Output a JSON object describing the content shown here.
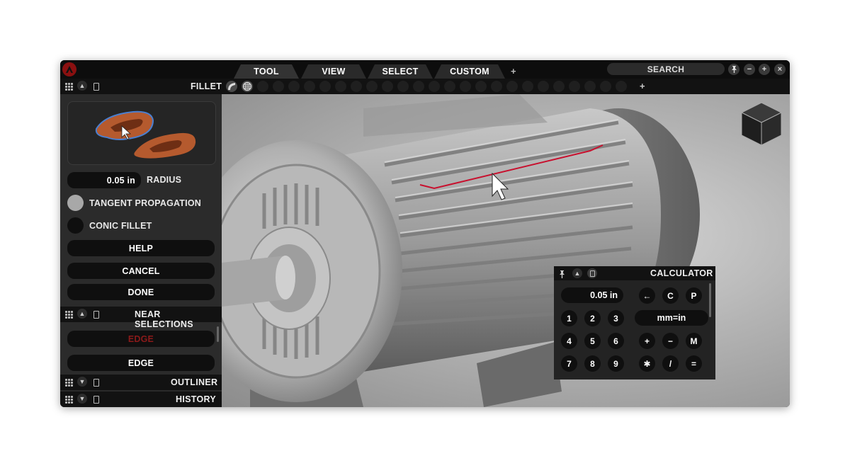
{
  "tabs": [
    {
      "label": "TOOL",
      "active": true
    },
    {
      "label": "VIEW",
      "active": false
    },
    {
      "label": "SELECT",
      "active": false
    },
    {
      "label": "CUSTOM",
      "active": false
    }
  ],
  "add_tab_label": "+",
  "search": {
    "label": "SEARCH"
  },
  "window_buttons": {
    "pin_icon": "pin-icon",
    "minimize": "−",
    "maximize": "+",
    "close": "×"
  },
  "toolbar": {
    "title": "FILLET",
    "add_label": "+"
  },
  "fillet": {
    "radius_value": "0.05 in",
    "radius_label": "RADIUS",
    "tangent_label": "TANGENT PROPAGATION",
    "conic_label": "CONIC FILLET",
    "help_label": "HELP",
    "cancel_label": "CANCEL",
    "done_label": "DONE"
  },
  "near_selections": {
    "title": "NEAR SELECTIONS",
    "items": [
      {
        "label": "EDGE",
        "color": "#8a1a1a"
      },
      {
        "label": "EDGE",
        "color": "#ffffff"
      }
    ]
  },
  "outliner": {
    "title": "OUTLINER"
  },
  "history": {
    "title": "HISTORY"
  },
  "calculator": {
    "title": "CALCULATOR",
    "display": "0.05 in",
    "back_label": "←",
    "clear_label": "C",
    "p_label": "P",
    "convert_label": "mm=in",
    "digits": [
      "1",
      "2",
      "3",
      "4",
      "5",
      "6",
      "7",
      "8",
      "9"
    ],
    "plus": "+",
    "minus": "−",
    "memory": "M",
    "multiply": "✱",
    "divide": "/",
    "equals": "="
  },
  "colors": {
    "accent": "#c8102e",
    "panel": "#2b2b2b",
    "bar": "#121212"
  }
}
